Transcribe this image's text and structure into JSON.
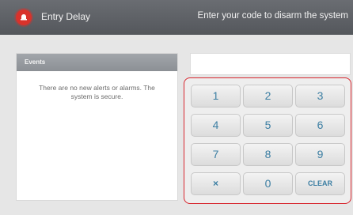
{
  "header": {
    "title": "Entry Delay",
    "instruction": "Enter your code to disarm the system",
    "icon": "alarm-icon",
    "icon_color": "#d9322b"
  },
  "events": {
    "title": "Events",
    "message": "There are no new alerts or alarms. The system is secure."
  },
  "code_display": {
    "value": ""
  },
  "keypad": {
    "border_color": "#d7262e",
    "keys": [
      "1",
      "2",
      "3",
      "4",
      "5",
      "6",
      "7",
      "8",
      "9",
      "×",
      "0",
      "CLEAR"
    ]
  },
  "colors": {
    "key_text": "#3d7fa3",
    "header_bg": "#5c5f64"
  }
}
